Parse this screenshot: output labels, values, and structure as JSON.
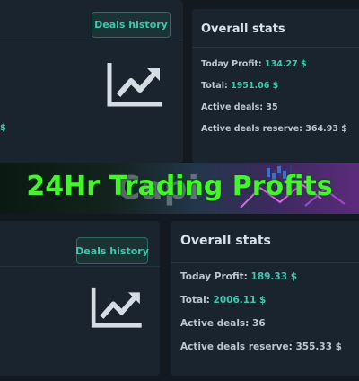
{
  "top": {
    "deals_history_label": "Deals history",
    "chart_icon": "trending-up-chart-icon",
    "stub_text": "$",
    "stats_title": "Overall stats",
    "rows": [
      {
        "label": "Today Profit:",
        "value": "134.27 $"
      },
      {
        "label": "Total:",
        "value": "1951.06 $"
      },
      {
        "label": "Active deals:",
        "value": "35"
      },
      {
        "label": "Active deals reserve:",
        "value": "364.93 $"
      }
    ]
  },
  "banner": {
    "title": "24Hr Trading Profits",
    "ghost_text": "Capi",
    "title_color": "#45f52c"
  },
  "bottom": {
    "deals_history_label": "Deals history",
    "chart_icon": "trending-up-chart-icon",
    "stats_title": "Overall stats",
    "rows": [
      {
        "label": "Today Profit:",
        "value": "189.33 $"
      },
      {
        "label": "Total:",
        "value": "2006.11 $"
      },
      {
        "label": "Active deals:",
        "value": "36"
      },
      {
        "label": "Active deals reserve:",
        "value": "355.33 $"
      }
    ]
  },
  "colors": {
    "accent": "#3fc7ad",
    "panel_bg": "#1a242f",
    "page_bg": "#121920"
  }
}
